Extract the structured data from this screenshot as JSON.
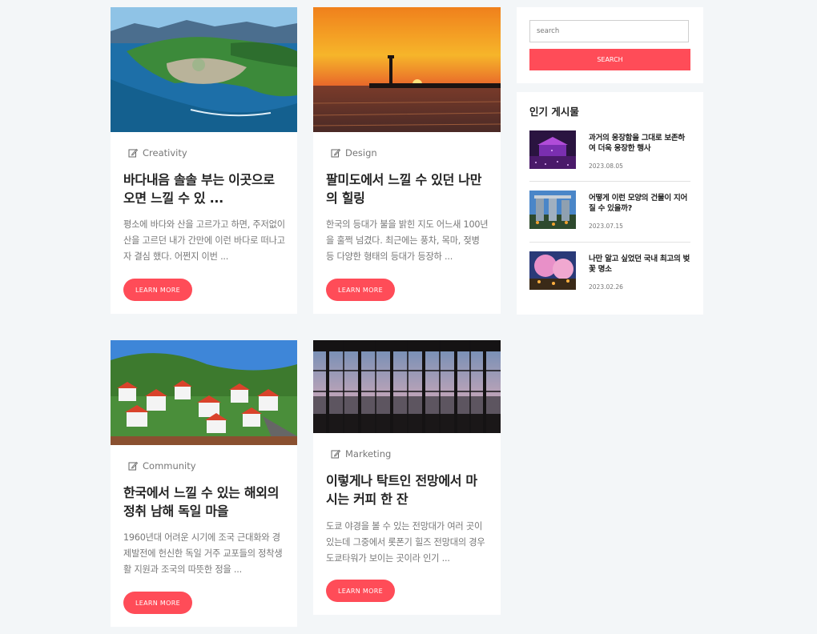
{
  "posts": [
    {
      "category": "Creativity",
      "title": "바다내음 솔솔 부는 이곳으로 오면 느낄 수 있 ...",
      "excerpt": "평소에 바다와 산을 고르가고 하면, 주저없이 산을 고르던 내가 간만에 이런 바다로 떠나고자 결심 했다. 어쩐지 이번 ...",
      "button": "LEARN MORE",
      "image": "coastal-town-photo"
    },
    {
      "category": "Design",
      "title": "팔미도에서 느낄 수 있던 나만의 힐링",
      "excerpt": "한국의 등대가 불을 밝힌 지도 어느새 100년을 훌쩍 넘겼다. 최근에는 풍차, 목마, 젖병 등 다양한 형태의 등대가 등장하 ...",
      "button": "LEARN MORE",
      "image": "lighthouse-sunset-photo"
    },
    {
      "category": "Community",
      "title": "한국에서 느낄 수 있는 해외의 정취 남해 독일 마을",
      "excerpt": "1960년대 어려운 시기에 조국 근대화와 경제발전에 헌신한 독일 거주 교포들의 정착생활 지원과 조국의 따뜻한 정을 ...",
      "button": "LEARN MORE",
      "image": "german-village-photo"
    },
    {
      "category": "Marketing",
      "title": "이렇게나 탁트인 전망에서 마시는 커피 한 잔",
      "excerpt": "도쿄 야경을 볼 수 있는 전망대가 여러 곳이 있는데 그중에서 롯폰기 힐즈 전망대의 경우 도쿄타워가 보이는 곳이라 인기 ...",
      "button": "LEARN MORE",
      "image": "observatory-city-view-photo"
    }
  ],
  "search": {
    "placeholder": "search",
    "button": "SEARCH"
  },
  "popular": {
    "heading": "인기 게시물",
    "items": [
      {
        "title": "과거의 웅장함을 그대로 보존하여 더욱 웅장한 행사",
        "date": "2023.08.05"
      },
      {
        "title": "어떻게 이런 모양의 건물이 지어질 수 있을까?",
        "date": "2023.07.15"
      },
      {
        "title": "나만 알고 싶었던 국내 최고의 벚꽃 명소",
        "date": "2023.02.26"
      }
    ]
  },
  "colors": {
    "accent": "#ff4c58",
    "background": "#f3f6f8"
  }
}
